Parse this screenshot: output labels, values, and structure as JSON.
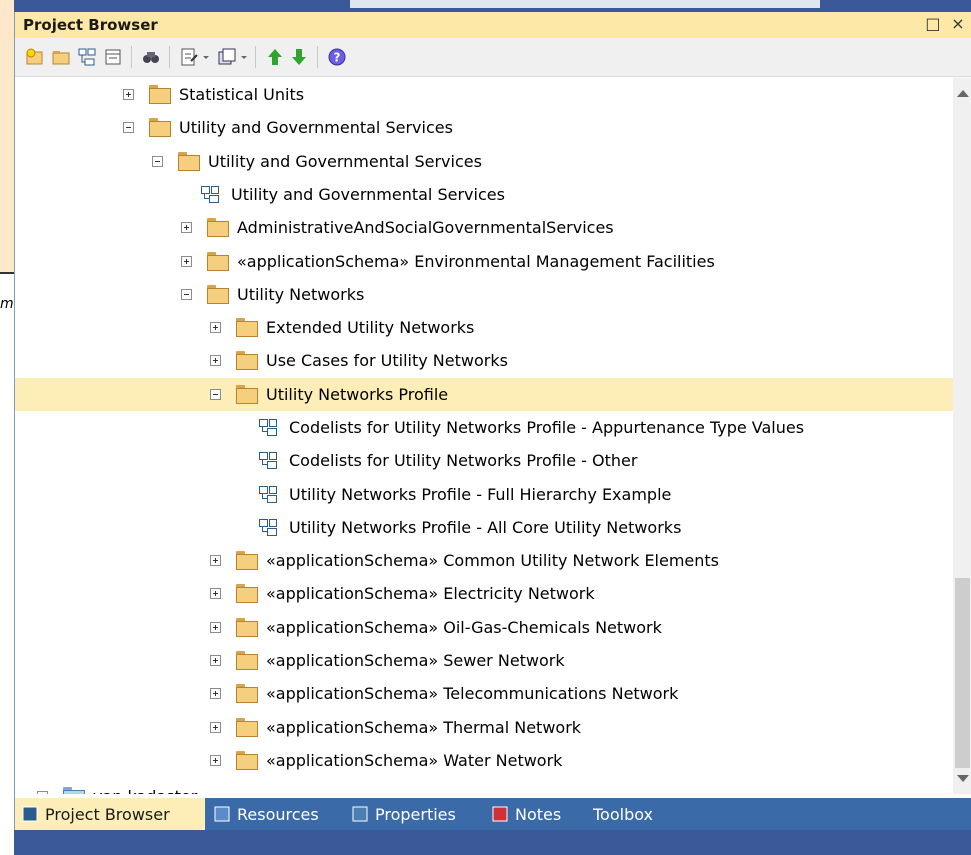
{
  "window": {
    "title": "Project Browser",
    "buttons": {
      "restore": "□",
      "close": "×"
    }
  },
  "background": {
    "fragment_text": "m"
  },
  "toolbar": {
    "icons": [
      "new-package-icon",
      "new-folder-icon",
      "new-diagram-icon",
      "new-element-icon",
      "find-icon",
      "properties-icon",
      "new-item-icon",
      "move-up-icon",
      "move-down-icon",
      "help-icon"
    ]
  },
  "tree": {
    "rows": [
      {
        "label": "Statistical Units",
        "type": "folder",
        "expander": "plus"
      },
      {
        "label": "Utility and Governmental Services",
        "type": "folder",
        "expander": "minus"
      },
      {
        "label": "Utility and Governmental Services",
        "type": "folder",
        "expander": "minus"
      },
      {
        "label": "Utility and Governmental Services",
        "type": "diagram",
        "expander": "none"
      },
      {
        "label": "AdministrativeAndSocialGovernmentalServices",
        "type": "folder",
        "expander": "plus"
      },
      {
        "label": "«applicationSchema» Environmental Management Facilities",
        "type": "folder",
        "expander": "plus"
      },
      {
        "label": "Utility Networks",
        "type": "folder",
        "expander": "minus"
      },
      {
        "label": "Extended Utility Networks",
        "type": "folder",
        "expander": "plus"
      },
      {
        "label": "Use Cases for Utility Networks",
        "type": "folder",
        "expander": "plus"
      },
      {
        "label": "Utility Networks Profile",
        "type": "folder",
        "expander": "minus",
        "selected": true
      },
      {
        "label": "Codelists for Utility Networks Profile - Appurtenance Type Values",
        "type": "diagram",
        "expander": "none"
      },
      {
        "label": "Codelists for Utility Networks Profile - Other",
        "type": "diagram",
        "expander": "none"
      },
      {
        "label": "Utility Networks Profile - Full Hierarchy Example",
        "type": "diagram",
        "expander": "none"
      },
      {
        "label": "Utility Networks Profile - All Core Utility Networks",
        "type": "diagram",
        "expander": "none"
      },
      {
        "label": "«applicationSchema» Common Utility Network Elements",
        "type": "folder",
        "expander": "plus"
      },
      {
        "label": "«applicationSchema» Electricity Network",
        "type": "folder",
        "expander": "plus"
      },
      {
        "label": "«applicationSchema» Oil-Gas-Chemicals Network",
        "type": "folder",
        "expander": "plus"
      },
      {
        "label": "«applicationSchema» Sewer Network",
        "type": "folder",
        "expander": "plus"
      },
      {
        "label": "«applicationSchema» Telecommunications Network",
        "type": "folder",
        "expander": "plus"
      },
      {
        "label": "«applicationSchema» Thermal Network",
        "type": "folder",
        "expander": "plus"
      },
      {
        "label": "«applicationSchema» Water Network",
        "type": "folder",
        "expander": "plus"
      },
      {
        "label": "van kadaster",
        "type": "root",
        "expander": "plus"
      }
    ]
  },
  "tabs": [
    {
      "label": "Project Browser",
      "icon": "project-browser-icon",
      "active": true
    },
    {
      "label": "Resources",
      "icon": "resources-icon",
      "active": false
    },
    {
      "label": "Properties",
      "icon": "properties-icon",
      "active": false
    },
    {
      "label": "Notes",
      "icon": "notes-icon",
      "active": false
    },
    {
      "label": "Toolbox",
      "icon": "",
      "active": false
    }
  ],
  "colors": {
    "title_bar": "#fde8a8",
    "selection": "#fdeeb8",
    "tab_bar": "#3b6aa8",
    "folder": "#f6cf7e"
  }
}
